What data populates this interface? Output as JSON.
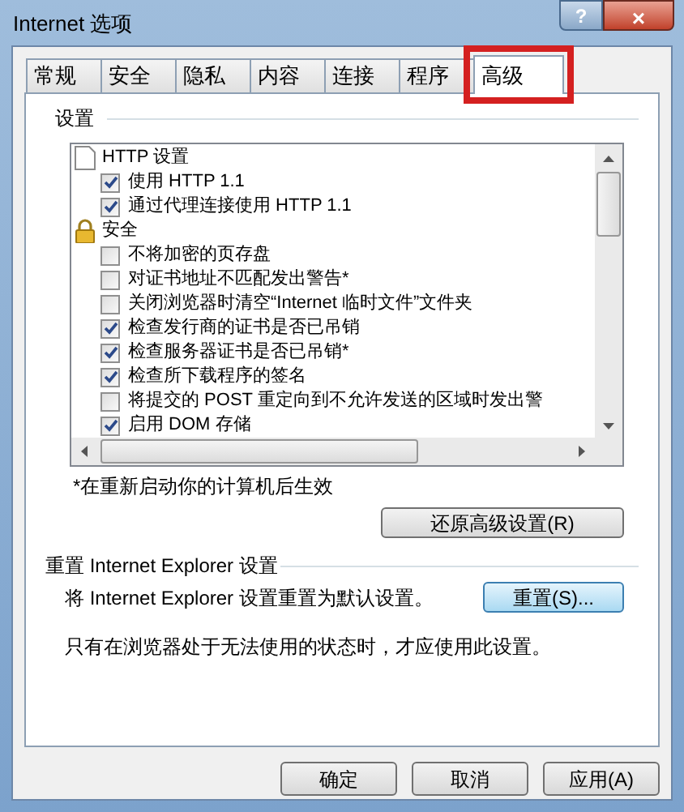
{
  "window": {
    "title": "Internet 选项",
    "help": "?",
    "close": "×"
  },
  "tabs": [
    {
      "label": "常规",
      "selected": false,
      "highlighted": false
    },
    {
      "label": "安全",
      "selected": false,
      "highlighted": false
    },
    {
      "label": "隐私",
      "selected": false,
      "highlighted": false
    },
    {
      "label": "内容",
      "selected": false,
      "highlighted": false
    },
    {
      "label": "连接",
      "selected": false,
      "highlighted": false
    },
    {
      "label": "程序",
      "selected": false,
      "highlighted": false
    },
    {
      "label": "高级",
      "selected": true,
      "highlighted": true
    }
  ],
  "settings": {
    "title": "设置",
    "groups": [
      {
        "label": "HTTP 设置",
        "kind": "page",
        "children": [
          {
            "label": "使用 HTTP 1.1",
            "checked": true
          },
          {
            "label": "通过代理连接使用 HTTP 1.1",
            "checked": true
          }
        ]
      },
      {
        "label": "安全",
        "kind": "lock",
        "children": [
          {
            "label": "不将加密的页存盘",
            "checked": false
          },
          {
            "label": "对证书地址不匹配发出警告*",
            "checked": false
          },
          {
            "label": "关闭浏览器时清空“Internet 临时文件”文件夹",
            "checked": false
          },
          {
            "label": "检查发行商的证书是否已吊销",
            "checked": true
          },
          {
            "label": "检查服务器证书是否已吊销*",
            "checked": true
          },
          {
            "label": "检查所下载程序的签名",
            "checked": true
          },
          {
            "label": "将提交的 POST 重定向到不允许发送的区域时发出警",
            "checked": false
          },
          {
            "label": "启用 DOM 存储",
            "checked": true
          }
        ]
      }
    ],
    "note": "*在重新启动你的计算机后生效",
    "restore_button": "还原高级设置(R)"
  },
  "reset": {
    "title": "重置 Internet Explorer 设置",
    "description": "将 Internet Explorer 设置重置为默认设置。",
    "button": "重置(S)...",
    "hint": "只有在浏览器处于无法使用的状态时，才应使用此设置。"
  },
  "buttons": [
    "确定",
    "取消",
    "应用(A)"
  ]
}
